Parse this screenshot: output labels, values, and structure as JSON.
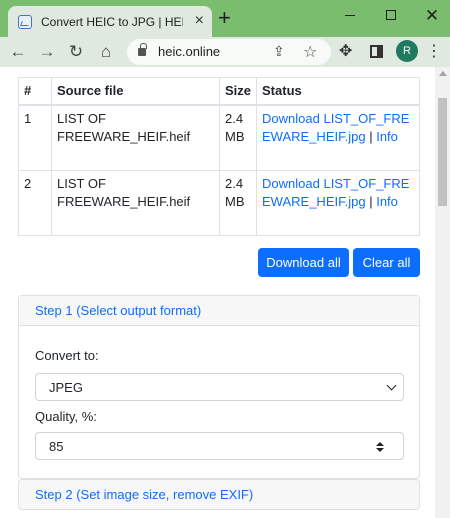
{
  "browser": {
    "tab_title": "Convert HEIC to JPG | HEIC.online",
    "tab_close": "×",
    "new_tab": "+",
    "url": "heic.online",
    "profile_initial": "R",
    "icons": [
      "back-arrow-icon",
      "forward-arrow-icon",
      "reload-icon",
      "home-icon",
      "lock-icon",
      "share-icon",
      "star-icon",
      "extensions-icon",
      "side-panel-icon",
      "menu-icon"
    ],
    "glyphs": {
      "back": "←",
      "forward": "→",
      "reload": "↻",
      "home": "⌂",
      "share": "⇪",
      "star": "☆",
      "extensions": "✥",
      "menu": "⋮",
      "close": "✕"
    },
    "theme_color": "#7bbd6e"
  },
  "files_table": {
    "headers": [
      "#",
      "Source file",
      "Size",
      "Status"
    ],
    "rows": [
      {
        "num": "1",
        "source": "LIST OF FREEWARE_HEIF.heif",
        "size": "2.4 MB",
        "status_prefix": "Download",
        "output": "LIST_OF_FREEWARE_HEIF.jpg",
        "separator": "|",
        "info": "Info"
      },
      {
        "num": "2",
        "source": "LIST OF FREEWARE_HEIF.heif",
        "size": "2.4 MB",
        "status_prefix": "Download",
        "output": "LIST_OF_FREEWARE_HEIF.jpg",
        "separator": "|",
        "info": "Info"
      }
    ]
  },
  "actions": {
    "download_all": "Download all",
    "clear_all": "Clear all",
    "accent_color": "#0d6efd"
  },
  "step1": {
    "title": "Step 1 (Select output format)",
    "convert_label": "Convert to:",
    "format_value": "JPEG",
    "quality_label": "Quality, %:",
    "quality_value": "85"
  },
  "step2": {
    "title": "Step 2 (Set image size, remove EXIF)"
  }
}
